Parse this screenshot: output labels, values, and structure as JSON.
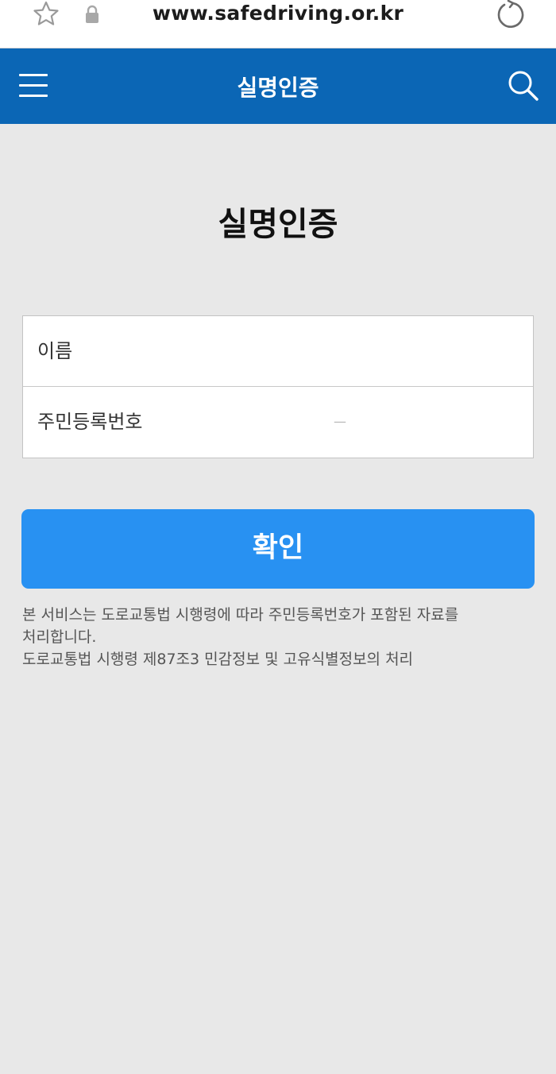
{
  "browser": {
    "url": "www.safedriving.or.kr",
    "star_icon": "star-outline-icon",
    "lock_icon": "lock-icon",
    "reload_icon": "reload-icon"
  },
  "header": {
    "title": "실명인증",
    "background": "#0b66b5",
    "menu_icon": "hamburger-menu-icon",
    "search_icon": "search-icon"
  },
  "main": {
    "heading": "실명인증",
    "form": {
      "name_label": "이름",
      "name_value": "",
      "rrn_label": "주민등록번호",
      "rrn_front_value": "",
      "rrn_separator": "—",
      "rrn_back_value": ""
    },
    "confirm_label": "확인",
    "confirm_color": "#2891f2",
    "notice": [
      "본 서비스는 도로교통법 시행령에 따라 주민등록번호가 포함된 자료를",
      "처리합니다.",
      "도로교통법 시행령 제87조3 민감정보 및 고유식별정보의 처리"
    ]
  }
}
